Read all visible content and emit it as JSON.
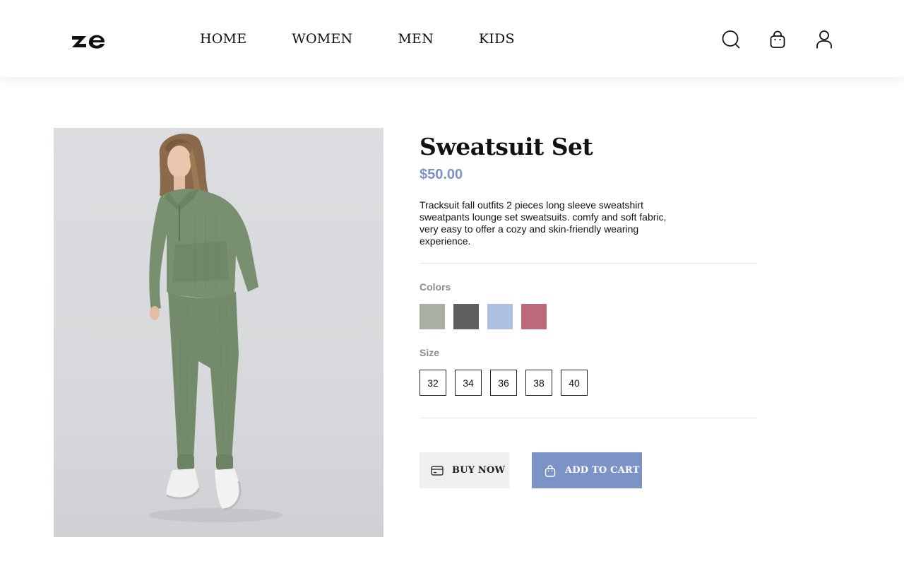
{
  "header": {
    "logo_text": "ze",
    "nav": {
      "home": "HOME",
      "women": "WOMEN",
      "men": "MEN",
      "kids": "KIDS"
    },
    "icons": [
      "search-icon",
      "shopping-bag-icon",
      "user-icon"
    ]
  },
  "product": {
    "title": "Sweatsuit Set",
    "price": "$50.00",
    "description": "Tracksuit fall outfits 2 pieces long sleeve sweatshirt sweatpants lounge set sweatsuits. comfy and soft fabric, very easy to offer a cozy and skin-friendly wearing experience.",
    "colors_label": "Colors",
    "colors": [
      "#a8b0a4",
      "#5f5f5f",
      "#adbfe3",
      "#bc6a79"
    ],
    "size_label": "Size",
    "sizes": [
      "32",
      "34",
      "36",
      "38",
      "40"
    ],
    "buy_now_label": "BUY NOW",
    "add_to_cart_label": "ADD TO CART"
  },
  "theme": {
    "accent": "#7b93c7"
  }
}
